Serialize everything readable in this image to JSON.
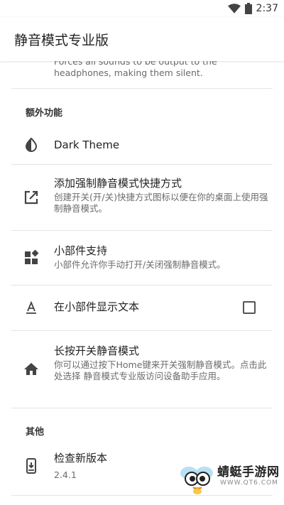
{
  "status_bar": {
    "time": "2:37",
    "icons": [
      "wifi-icon",
      "battery-icon"
    ]
  },
  "app_bar": {
    "title": "静音模式专业版"
  },
  "clipped_summary": "Forces all sounds to be output to the headphones, making them silent.",
  "categories": {
    "extra": "额外功能",
    "other": "其他"
  },
  "prefs": {
    "dark_theme": {
      "title": "Dark Theme",
      "icon": "contrast-icon"
    },
    "shortcut": {
      "title": "添加强制静音模式快捷方式",
      "summary": "创建开关(开/关)快捷方式图标以便在你的桌面上使用强制静音模式。",
      "icon": "external-link-icon"
    },
    "widget": {
      "title": "小部件支持",
      "summary": "小部件允许你手动打开/关闭强制静音模式。",
      "icon": "widgets-icon"
    },
    "widget_text": {
      "title": "在小部件显示文本",
      "icon": "text-format-icon",
      "checked": false
    },
    "long_press": {
      "title": "长按开关静音模式",
      "summary": "你可以通过按下Home键来开关强制静音模式。点击此处选择 静音模式专业版访问设备助手应用。",
      "icon": "home-icon"
    },
    "update": {
      "title": "检查新版本",
      "summary": "2.4.1",
      "icon": "system-update-icon"
    }
  },
  "watermark": {
    "text": "蜻蜓手游网",
    "url": "WWW.QT6.COM"
  },
  "colors": {
    "icon": "#444444",
    "divider": "#e4e4e4",
    "summary": "#6b6b6b"
  }
}
